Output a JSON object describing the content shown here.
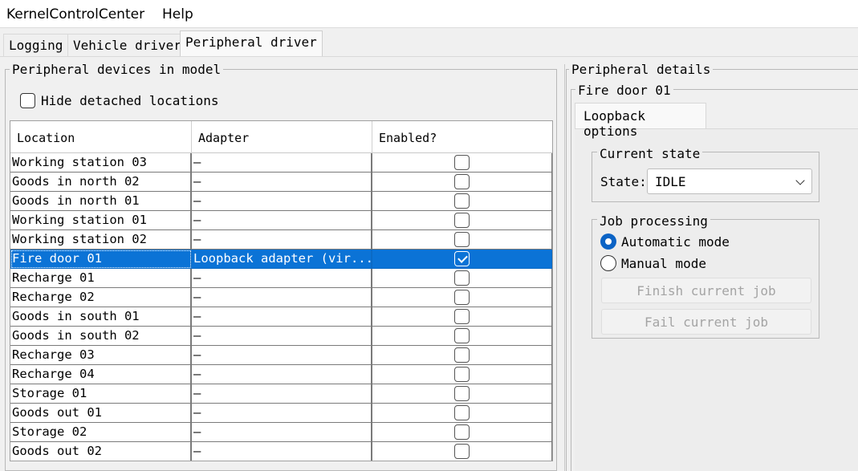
{
  "menu": [
    "KernelControlCenter",
    "Help"
  ],
  "tabs": [
    "Logging",
    "Vehicle driver",
    "Peripheral driver"
  ],
  "left_panel": {
    "title": "Peripheral devices in model",
    "hide_detached_label": "Hide detached locations",
    "hide_detached_checked": false,
    "columns": [
      "Location",
      "Adapter",
      "Enabled?"
    ],
    "rows": [
      {
        "location": "Working station 03",
        "adapter": "–",
        "enabled": false
      },
      {
        "location": "Goods in north 02",
        "adapter": "–",
        "enabled": false
      },
      {
        "location": "Goods in north 01",
        "adapter": "–",
        "enabled": false
      },
      {
        "location": "Working station 01",
        "adapter": "–",
        "enabled": false
      },
      {
        "location": "Working station 02",
        "adapter": "–",
        "enabled": false
      },
      {
        "location": "Fire door 01",
        "adapter": "Loopback adapter (vir...",
        "enabled": true,
        "selected": true
      },
      {
        "location": "Recharge 01",
        "adapter": "–",
        "enabled": false
      },
      {
        "location": "Recharge 02",
        "adapter": "–",
        "enabled": false
      },
      {
        "location": "Goods in south 01",
        "adapter": "–",
        "enabled": false
      },
      {
        "location": "Goods in south 02",
        "adapter": "–",
        "enabled": false
      },
      {
        "location": "Recharge 03",
        "adapter": "–",
        "enabled": false
      },
      {
        "location": "Recharge 04",
        "adapter": "–",
        "enabled": false
      },
      {
        "location": "Storage 01",
        "adapter": "–",
        "enabled": false
      },
      {
        "location": "Goods out 01",
        "adapter": "–",
        "enabled": false
      },
      {
        "location": "Storage 02",
        "adapter": "–",
        "enabled": false
      },
      {
        "location": "Goods out 02",
        "adapter": "–",
        "enabled": false
      }
    ]
  },
  "right_panel": {
    "title": "Peripheral details",
    "device_title": "Fire door 01",
    "subtab": "Loopback options",
    "current_state": {
      "title": "Current state",
      "state_label": "State:",
      "state_value": "IDLE"
    },
    "job_processing": {
      "title": "Job processing",
      "automatic_label": "Automatic mode",
      "manual_label": "Manual mode",
      "selected_mode": "automatic",
      "finish_button": "Finish current job",
      "fail_button": "Fail current job"
    }
  },
  "colors": {
    "selection": "#0b73d6",
    "radio_accent": "#0b63c5"
  }
}
